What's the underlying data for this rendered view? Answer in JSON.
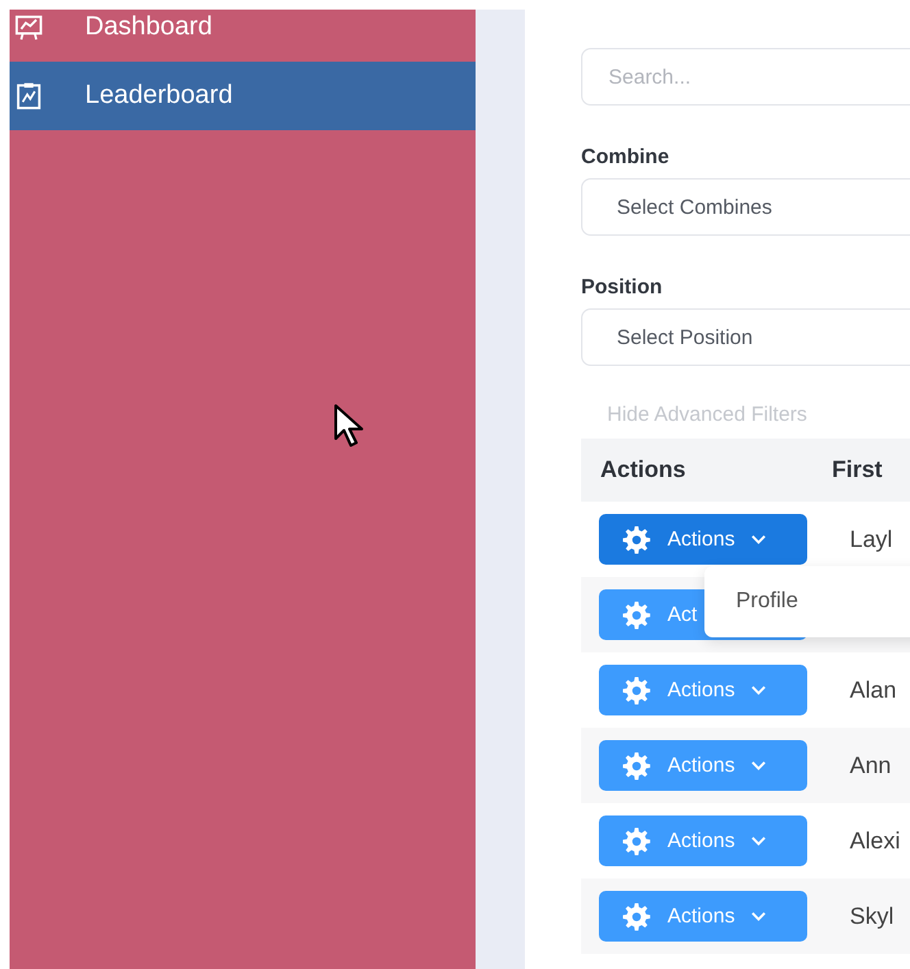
{
  "sidebar": {
    "items": [
      {
        "label": "Dashboard",
        "selected": false
      },
      {
        "label": "Leaderboard",
        "selected": true
      }
    ]
  },
  "search": {
    "placeholder": "Search..."
  },
  "filters": [
    {
      "label": "Combine",
      "placeholder": "Select Combines"
    },
    {
      "label": "Position",
      "placeholder": "Select Position"
    }
  ],
  "toggle_filters": "Hide Advanced Filters",
  "table": {
    "columns": [
      "Actions",
      "First"
    ],
    "rows": [
      {
        "action": "Actions",
        "open": true,
        "first": "Layl",
        "menu": {
          "items": [
            "Profile"
          ]
        }
      },
      {
        "action": "Act",
        "open": false
      },
      {
        "action": "Actions",
        "open": false,
        "first": "Alan"
      },
      {
        "action": "Actions",
        "open": false,
        "first": "Ann"
      },
      {
        "action": "Actions",
        "open": false,
        "first": "Alexi"
      },
      {
        "action": "Actions",
        "open": false,
        "first": "Skyl"
      }
    ]
  }
}
